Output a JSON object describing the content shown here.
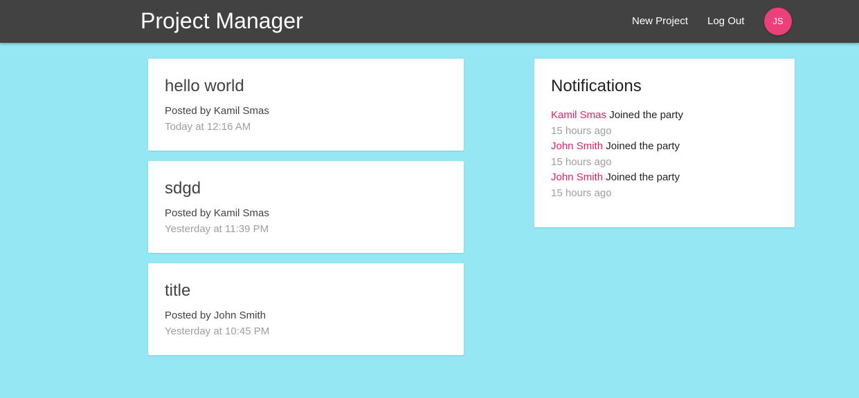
{
  "navbar": {
    "brand": "Project Manager",
    "links": {
      "new_project": "New Project",
      "log_out": "Log Out"
    },
    "avatar_initials": "JS",
    "colors": {
      "background": "#424242",
      "avatar": "#ec407a"
    }
  },
  "projects": [
    {
      "title": "hello world",
      "author": "Posted by Kamil Smas",
      "date": "Today at 12:16 AM"
    },
    {
      "title": "sdgd",
      "author": "Posted by Kamil Smas",
      "date": "Yesterday at 11:39 PM"
    },
    {
      "title": "title",
      "author": "Posted by John Smith",
      "date": "Yesterday at 10:45 PM"
    }
  ],
  "notifications": {
    "title": "Notifications",
    "items": [
      {
        "user": "Kamil Smas",
        "text": "Joined the party",
        "time": "15 hours ago"
      },
      {
        "user": "John Smith",
        "text": "Joined the party",
        "time": "15 hours ago"
      },
      {
        "user": "John Smith",
        "text": "Joined the party",
        "time": "15 hours ago"
      }
    ]
  },
  "colors": {
    "page_background": "#95e7f3",
    "accent": "#e91e63"
  }
}
